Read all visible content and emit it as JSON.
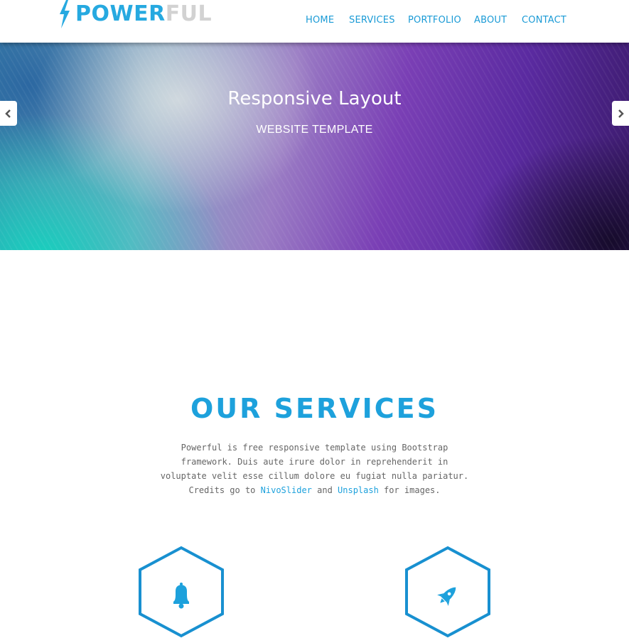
{
  "header": {
    "logo": {
      "part1": "POWER",
      "part2": "FUL"
    },
    "nav": [
      "HOME",
      "SERVICES",
      "PORTFOLIO",
      "ABOUT",
      "CONTACT"
    ]
  },
  "hero": {
    "title": "Responsive Layout",
    "subtitle": "WEBSITE TEMPLATE"
  },
  "services": {
    "title": "OUR SERVICES",
    "desc_text1": "Powerful is free responsive template using Bootstrap framework. Duis aute irure dolor in reprehenderit in voluptate velit esse cillum dolore eu fugiat nulla pariatur. Credits go to ",
    "link1": "NivoSlider",
    "desc_text2": " and ",
    "link2": "Unsplash",
    "desc_text3": " for images.",
    "icons": [
      "bell-icon",
      "rocket-icon"
    ]
  },
  "colors": {
    "accent": "#1da1dc",
    "logo_blue": "#26a9e0",
    "logo_gray": "#d2d2d2",
    "text": "#666666"
  }
}
